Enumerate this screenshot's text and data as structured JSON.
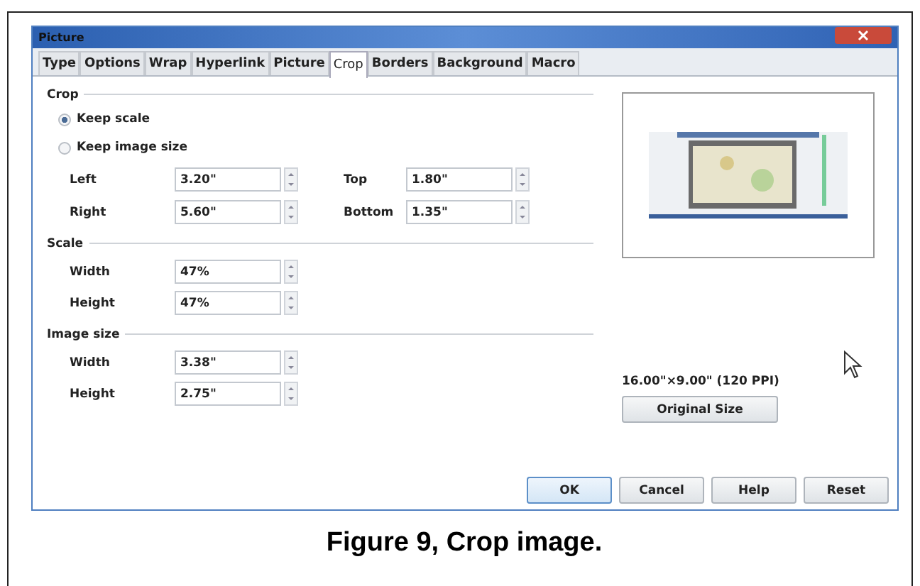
{
  "window": {
    "title": "Picture"
  },
  "tabs": [
    {
      "label": "Type",
      "selected": false
    },
    {
      "label": "Options",
      "selected": false
    },
    {
      "label": "Wrap",
      "selected": false
    },
    {
      "label": "Hyperlink",
      "selected": false
    },
    {
      "label": "Picture",
      "selected": false
    },
    {
      "label": "Crop",
      "selected": true
    },
    {
      "label": "Borders",
      "selected": false
    },
    {
      "label": "Background",
      "selected": false
    },
    {
      "label": "Macro",
      "selected": false
    }
  ],
  "crop": {
    "heading": "Crop",
    "options": [
      {
        "label": "Keep scale",
        "selected": true
      },
      {
        "label": "Keep image size",
        "selected": false
      }
    ],
    "fields": [
      {
        "label": "Left",
        "value": "3.20\""
      },
      {
        "label": "Top",
        "value": "1.80\""
      },
      {
        "label": "Right",
        "value": "5.60\""
      },
      {
        "label": "Bottom",
        "value": "1.35\""
      }
    ]
  },
  "scale": {
    "heading": "Scale",
    "fields": [
      {
        "label": "Width",
        "value": "47%"
      },
      {
        "label": "Height",
        "value": "47%"
      }
    ]
  },
  "image_size": {
    "heading": "Image size",
    "fields": [
      {
        "label": "Width",
        "value": "3.38\""
      },
      {
        "label": "Height",
        "value": "2.75\""
      }
    ]
  },
  "original_dimensions": "16.00\"×9.00\" (120 PPI)",
  "original_size_button": "Original Size",
  "buttons": [
    "OK",
    "Cancel",
    "Help",
    "Reset"
  ],
  "caption": "Figure 9, Crop image."
}
